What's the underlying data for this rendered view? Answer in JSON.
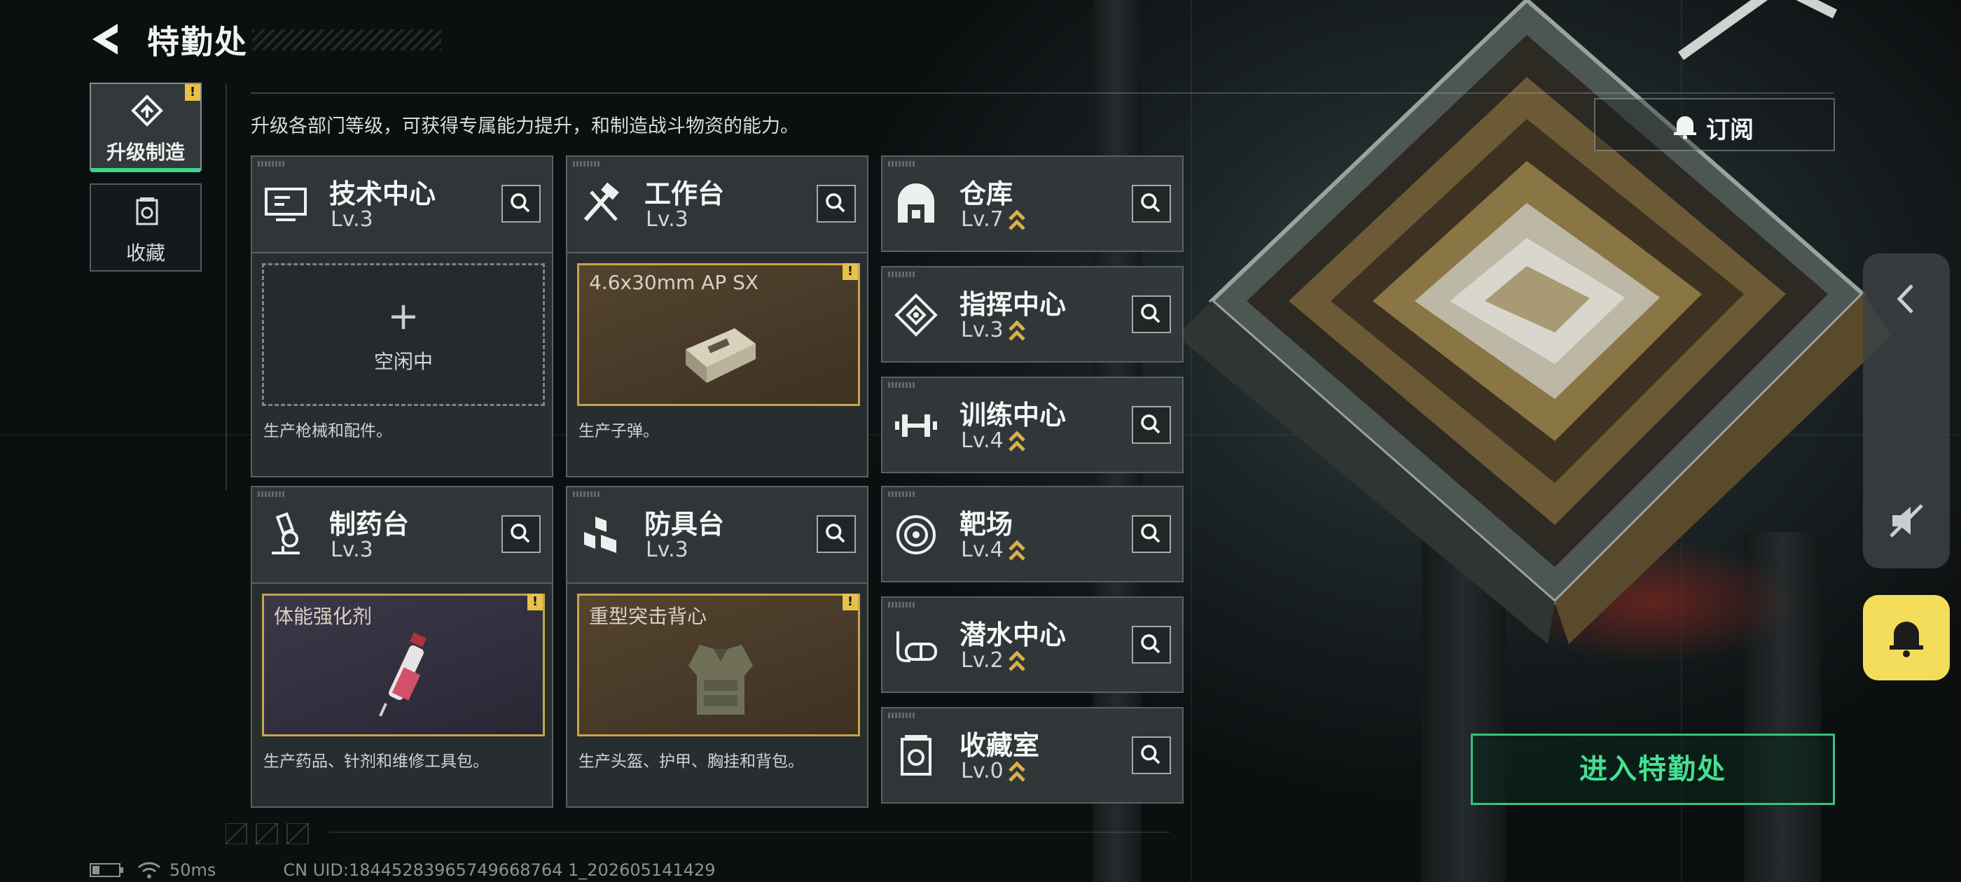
{
  "header": {
    "title": "特勤处",
    "subtitle": "升级各部门等级，可获得专属能力提升，和制造战斗物资的能力。"
  },
  "tabs": [
    {
      "label": "升级制造",
      "icon": "upgrade-icon",
      "active": true,
      "alert": "!"
    },
    {
      "label": "收藏",
      "icon": "collection-icon",
      "active": false
    }
  ],
  "production": [
    {
      "name": "技术中心",
      "level": "Lv.3",
      "icon": "tech-center-icon",
      "slot_state": "空闲中",
      "slot_plus": "+",
      "desc": "生产枪械和配件。"
    },
    {
      "name": "工作台",
      "level": "Lv.3",
      "icon": "workbench-icon",
      "item": "4.6x30mm AP SX",
      "item_icon": "ammo-box-icon",
      "alert": "!",
      "desc": "生产子弹。"
    },
    {
      "name": "制药台",
      "level": "Lv.3",
      "icon": "pharmacy-icon",
      "item": "体能强化剂",
      "item_icon": "syringe-icon",
      "alert": "!",
      "desc": "生产药品、针剂和维修工具包。"
    },
    {
      "name": "防具台",
      "level": "Lv.3",
      "icon": "armor-bench-icon",
      "item": "重型突击背心",
      "item_icon": "vest-icon",
      "alert": "!",
      "desc": "生产头盔、护甲、胸挂和背包。"
    }
  ],
  "facilities": [
    {
      "name": "仓库",
      "level": "Lv.7",
      "icon": "warehouse-icon",
      "upgradable": true
    },
    {
      "name": "指挥中心",
      "level": "Lv.3",
      "icon": "command-center-icon",
      "upgradable": true
    },
    {
      "name": "训练中心",
      "level": "Lv.4",
      "icon": "training-center-icon",
      "upgradable": true
    },
    {
      "name": "靶场",
      "level": "Lv.4",
      "icon": "shooting-range-icon",
      "upgradable": true
    },
    {
      "name": "潜水中心",
      "level": "Lv.2",
      "icon": "diving-center-icon",
      "upgradable": true
    },
    {
      "name": "收藏室",
      "level": "Lv.0",
      "icon": "collection-room-icon",
      "upgradable": true
    }
  ],
  "right": {
    "subscribe_label": "订阅",
    "enter_label": "进入特勤处"
  },
  "status": {
    "ping": "50ms",
    "uid": "CN UID:18445283965749668764 1_202605141429"
  },
  "colors": {
    "accent_green": "#45e092",
    "alert_yellow": "#e8c14a",
    "notify_yellow": "#f3dd5a",
    "upgrade_gold": "#d9b04a"
  }
}
